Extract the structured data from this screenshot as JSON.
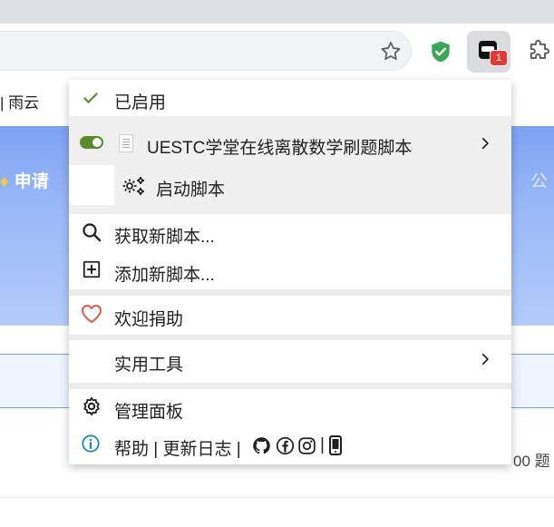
{
  "browser": {
    "extension_badge": "1",
    "icons": [
      "star-icon",
      "shield-icon",
      "tampermonkey-icon",
      "puzzle-icon"
    ],
    "colors": {
      "shield": "#3aa757",
      "badge": "#e53935"
    }
  },
  "page": {
    "crumb": "| 雨云",
    "banner_left": "申请",
    "banner_right": "公",
    "count_text": "00 题"
  },
  "menu": {
    "enabled_label": "已启用",
    "script_name": "UESTC学堂在线离散数学刷题脚本",
    "launch_label": "启动脚本",
    "get_new_label": "获取新脚本...",
    "add_new_label": "添加新脚本...",
    "donate_label": "欢迎捐助",
    "utilities_label": "实用工具",
    "dashboard_label": "管理面板",
    "help_label": "帮助",
    "changelog_label": "| 更新日志 |",
    "pipe": "|",
    "colors": {
      "check": "#5b8a2d",
      "toggle_on": "#5b8a2d",
      "heart": "#e05a47",
      "info": "#1e88b9"
    }
  }
}
